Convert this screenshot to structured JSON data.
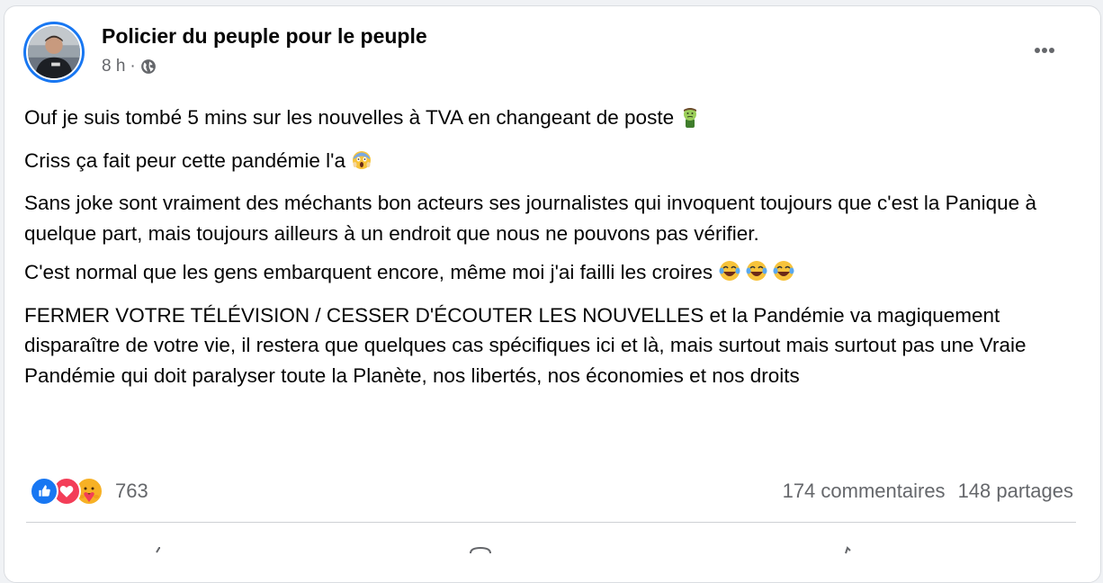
{
  "post": {
    "author": "Policier du peuple pour le peuple",
    "time": "8 h",
    "separator": "·",
    "privacy_icon": "globe-icon",
    "more_icon": "more-horizontal-icon",
    "paragraphs": [
      {
        "text": "Ouf je suis tombé 5 mins sur les nouvelles à TVA  en changeant de poste ",
        "emoji": "nauseated-face-emoji"
      },
      {
        "text": "Criss ça fait peur cette pandémie l'a ",
        "emoji": "screaming-face-emoji"
      },
      {
        "text": "Sans joke sont vraiment des méchants bon acteurs ses journalistes qui invoquent toujours que c'est la Panique à quelque part, mais toujours ailleurs à un endroit que nous ne pouvons pas vérifier."
      },
      {
        "text": "C'est normal que les gens embarquent encore, même moi j'ai failli les croires ",
        "emoji": "tears-of-joy-emoji x3"
      },
      {
        "text": "FERMER VOTRE TÉLÉVISION /  CESSER D'ÉCOUTER LES NOUVELLES et la Pandémie va magiquement disparaître de votre vie, il restera que quelques cas spécifiques ici et là, mais surtout mais surtout pas une Vraie Pandémie qui doit paralyser toute la Planète, nos libertés, nos économies et nos droits"
      }
    ]
  },
  "reactions": {
    "icons": [
      "like-icon",
      "love-icon",
      "care-icon"
    ],
    "count": "763",
    "colors": {
      "like": "#1877f2",
      "love": "#f33e58",
      "care": "#f7b125"
    }
  },
  "stats": {
    "comments": "174 commentaires",
    "shares": "148 partages"
  },
  "colors": {
    "text": "#050505",
    "secondary": "#65676b",
    "accent": "#1877f2"
  }
}
